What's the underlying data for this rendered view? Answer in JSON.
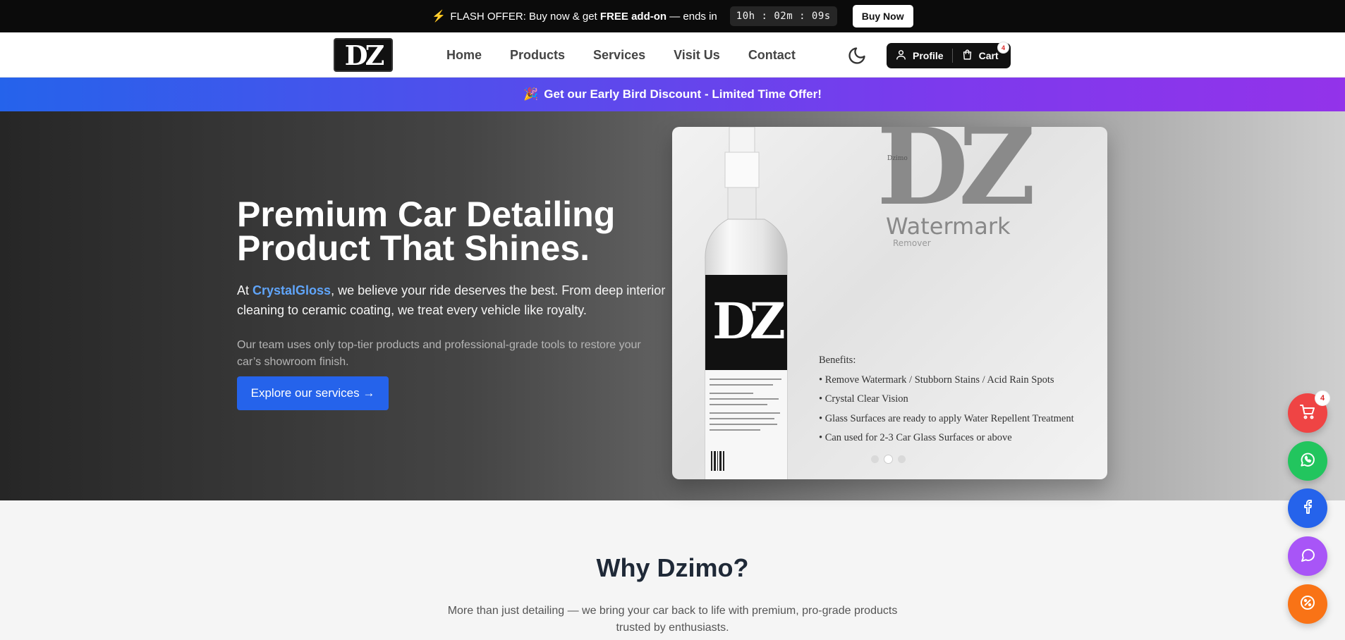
{
  "flash": {
    "icon": "lightning-icon",
    "prefix": "FLASH OFFER: Buy now & get ",
    "highlight": "FREE add-on",
    "suffix": " — ends in",
    "timer": "10h : 02m : 09s",
    "button": "Buy Now"
  },
  "nav": {
    "logo": "DZ",
    "links": [
      "Home",
      "Products",
      "Services",
      "Visit Us",
      "Contact"
    ],
    "profile_label": "Profile",
    "cart_label": "Cart",
    "cart_count": "4"
  },
  "promo": {
    "icon": "🎉",
    "text": "Get our Early Bird Discount - Limited Time Offer!"
  },
  "hero": {
    "title": "Premium Car Detailing Product That Shines.",
    "body_prefix": "At ",
    "brand": "CrystalGloss",
    "body_suffix": ", we believe your ride deserves the best. From deep interior cleaning to ceramic coating, we treat every vehicle like royalty.",
    "sub": "Our team uses only top-tier products and professional-grade tools to restore your car’s showroom finish.",
    "cta": "Explore our services →"
  },
  "carousel": {
    "logo": "DZ",
    "maker": "Dzimo",
    "product_line1": "Watermark",
    "product_line2": "Remover",
    "benefits_title": "Benefits:",
    "benefits": [
      "• Remove Watermark / Stubborn Stains / Acid Rain Spots",
      "• Crystal Clear Vision",
      "• Glass Surfaces are ready to apply Water Repellent Treatment",
      "• Can used for 2-3 Car Glass Surfaces or above"
    ],
    "slide_count": 3,
    "active_slide": 2
  },
  "why": {
    "title": "Why Dzimo?",
    "subtitle": "More than just detailing — we bring your car back to life with premium, pro-grade products trusted by enthusiasts."
  },
  "fabs": [
    {
      "name": "cart-fab",
      "icon": "cart-icon",
      "color": "#ef4444",
      "badge": "4"
    },
    {
      "name": "whatsapp-fab",
      "icon": "whatsapp-icon",
      "color": "#22c55e"
    },
    {
      "name": "facebook-fab",
      "icon": "facebook-icon",
      "color": "#2563eb"
    },
    {
      "name": "chat-fab",
      "icon": "chat-icon",
      "color": "#a855f7"
    },
    {
      "name": "discount-fab",
      "icon": "discount-icon",
      "color": "#f97316"
    }
  ],
  "colors": {
    "accent": "#2563eb",
    "brand_link": "#60a5fa",
    "promo_gradient": [
      "#2563eb",
      "#9333ea"
    ]
  }
}
